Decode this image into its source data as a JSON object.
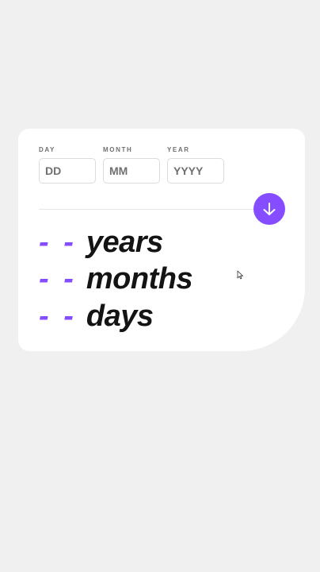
{
  "form": {
    "day": {
      "label": "DAY",
      "placeholder": "DD",
      "value": ""
    },
    "month": {
      "label": "MONTH",
      "placeholder": "MM",
      "value": ""
    },
    "year": {
      "label": "YEAR",
      "placeholder": "YYYY",
      "value": ""
    }
  },
  "submit": {
    "icon": "arrow-down-icon"
  },
  "results": {
    "years": {
      "value": "- -",
      "unit": "years"
    },
    "months": {
      "value": "- -",
      "unit": "months"
    },
    "days": {
      "value": "- -",
      "unit": "days"
    }
  },
  "colors": {
    "accent": "#854dff",
    "text": "#141414",
    "muted": "#716f6f",
    "background": "#f0f0f0",
    "card": "#ffffff"
  }
}
